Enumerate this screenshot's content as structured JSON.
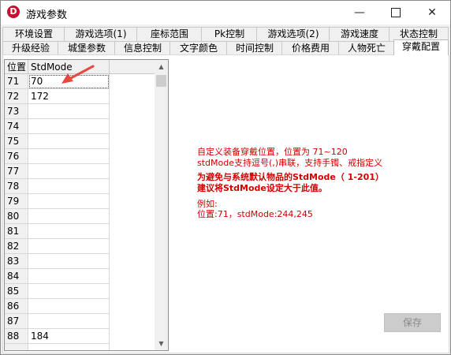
{
  "window": {
    "title": "游戏参数",
    "icon_letter": "D",
    "minimize": "—",
    "close": "✕"
  },
  "tabs_row1": [
    "环境设置",
    "游戏选项(1)",
    "座标范围",
    "Pk控制",
    "游戏选项(2)",
    "游戏速度",
    "状态控制"
  ],
  "tabs_row2": [
    "升级经验",
    "城堡参数",
    "信息控制",
    "文字颜色",
    "时间控制",
    "价格费用",
    "人物死亡",
    "穿戴配置"
  ],
  "active_tab": "穿戴配置",
  "grid": {
    "headers": [
      "位置",
      "StdMode"
    ],
    "rows": [
      {
        "pos": "71",
        "std": "70"
      },
      {
        "pos": "72",
        "std": "172"
      },
      {
        "pos": "73",
        "std": ""
      },
      {
        "pos": "74",
        "std": ""
      },
      {
        "pos": "75",
        "std": ""
      },
      {
        "pos": "76",
        "std": ""
      },
      {
        "pos": "77",
        "std": ""
      },
      {
        "pos": "78",
        "std": ""
      },
      {
        "pos": "79",
        "std": ""
      },
      {
        "pos": "80",
        "std": ""
      },
      {
        "pos": "81",
        "std": ""
      },
      {
        "pos": "82",
        "std": ""
      },
      {
        "pos": "83",
        "std": ""
      },
      {
        "pos": "84",
        "std": ""
      },
      {
        "pos": "85",
        "std": ""
      },
      {
        "pos": "86",
        "std": ""
      },
      {
        "pos": "87",
        "std": ""
      },
      {
        "pos": "88",
        "std": "184"
      },
      {
        "pos": "",
        "std": ""
      }
    ]
  },
  "notes": {
    "line1": "自定义装备穿戴位置，位置为 71~120",
    "line2": "stdMode支持逗号(,)串联，支持手镯、戒指定义",
    "line3": "为避免与系统默认物品的StdMode（ 1-201）",
    "line4": "建议将StdMode设定大于此值。",
    "line5": "例如:",
    "line6": "位置:71，stdMode:244,245"
  },
  "save_button": "保存",
  "colors": {
    "note_red": "#d00000",
    "arrow_red": "#e8493f"
  }
}
